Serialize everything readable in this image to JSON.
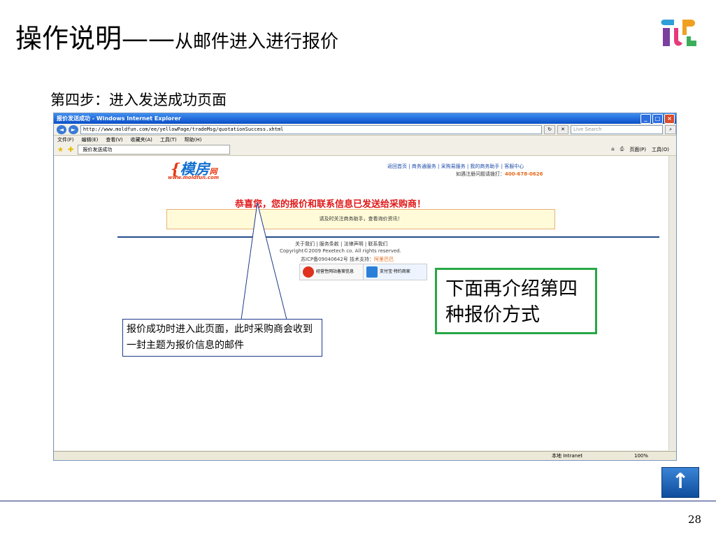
{
  "slide": {
    "title_main": "操作说明——",
    "title_sub": "从邮件进入进行报价",
    "step": "第四步：进入发送成功页面",
    "page_number": "28"
  },
  "browser": {
    "window_title": "报价发送成功 - Windows Internet Explorer",
    "address": "http://www.moldfun.com/ee/yellowPage/tradeMsg/quotationSuccess.xhtml",
    "search_placeholder": "Live Search",
    "menu": [
      "文件(F)",
      "编辑(E)",
      "查看(V)",
      "收藏夹(A)",
      "工具(T)",
      "帮助(H)"
    ],
    "tab_label": "报价发送成功",
    "toolbar_right": [
      "页面(P)",
      "工具(O)"
    ],
    "status_zone": "本地 Intranet",
    "zoom": "100%"
  },
  "site": {
    "logo_text": "模房",
    "logo_suffix": "网",
    "logo_url": "www.moldfun.com",
    "top_nav": "返回首页 | 商务通服务 | 采购易服务 | 我的商务助手 | 客服中心",
    "hotline_label": "如遇注册问题请拨打：",
    "hotline_number": "400-678-0626",
    "congrats": "恭喜您，您的报价和联系信息已发送给采购商！",
    "notice": "请及时关注商务助手，查看询价资讯！",
    "footer_links": "关于我们 | 服务条款 | 法律声明 | 联系我们",
    "copyright": "Copyright©2009 Pexetech co. All rights reserved.",
    "icp": "苏ICP备09040642号 技术支持：",
    "icp_support": "阿里巴巴",
    "badge1": "经营性网站备案信息",
    "badge2": "支付宝·特约商家"
  },
  "annotations": {
    "callout": "报价成功时进入此页面，此时采购商会收到一封主题为报价信息的邮件",
    "note": "下面再介绍第四种报价方式"
  },
  "nav": {
    "back_symbol": "↑"
  }
}
